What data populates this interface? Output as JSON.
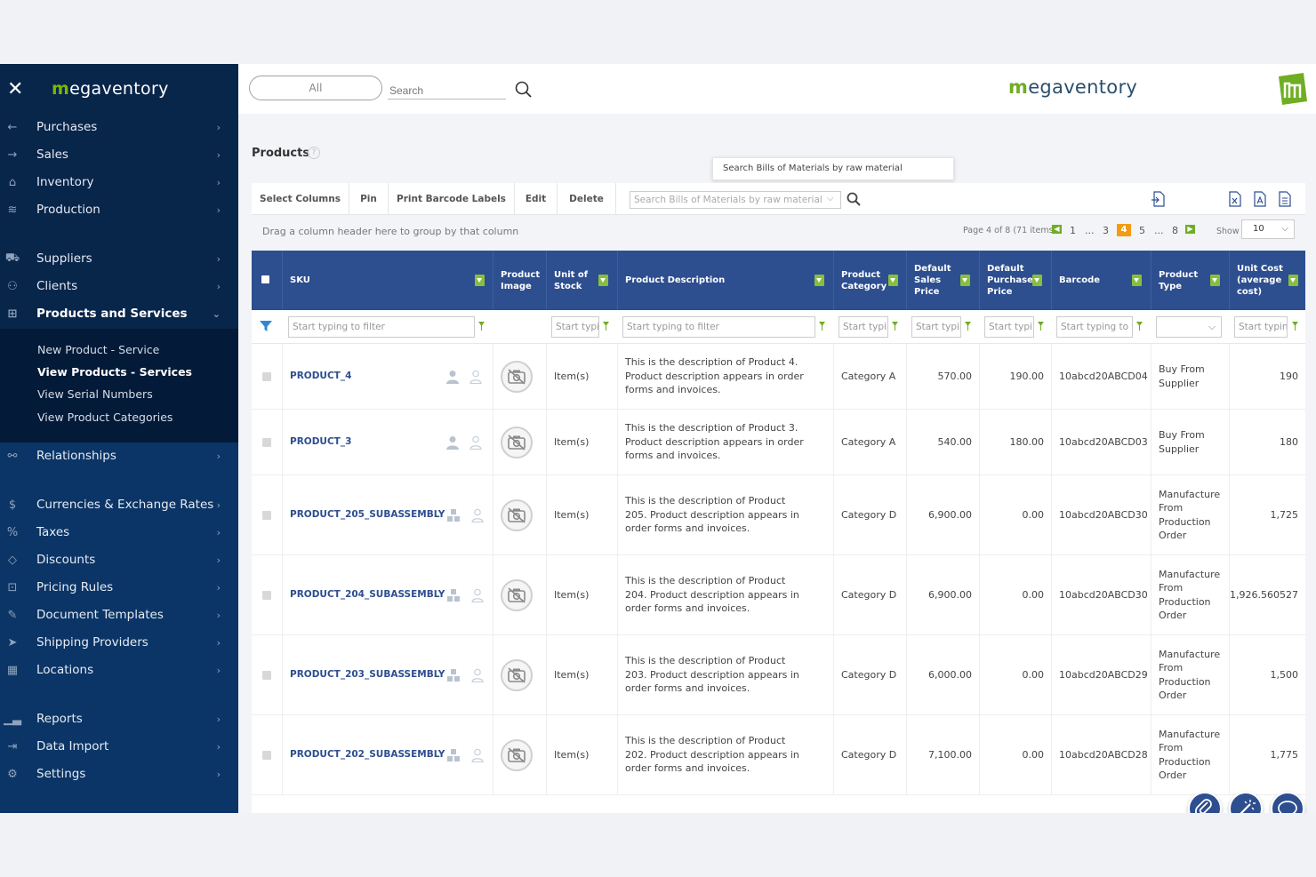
{
  "sidebar": {
    "logo": "megaventory",
    "logo_initial": "m",
    "logo_rest": "egaventory",
    "items_top": [
      {
        "label": "Purchases",
        "icon": "arrow-left-icon"
      },
      {
        "label": "Sales",
        "icon": "arrow-right-icon"
      },
      {
        "label": "Inventory",
        "icon": "warehouse-icon"
      },
      {
        "label": "Production",
        "icon": "layers-icon"
      }
    ],
    "items_mid": [
      {
        "label": "Suppliers",
        "icon": "truck-icon"
      },
      {
        "label": "Clients",
        "icon": "users-icon"
      },
      {
        "label": "Products and Services",
        "icon": "gift-icon"
      }
    ],
    "sub_items": [
      {
        "label": "New Product - Service"
      },
      {
        "label": "View Products - Services"
      },
      {
        "label": "View Serial Numbers"
      },
      {
        "label": "View Product Categories"
      }
    ],
    "items_lower": [
      {
        "label": "Relationships",
        "icon": "network-icon"
      },
      {
        "label": "Currencies & Exchange Rates",
        "icon": "currency-icon"
      },
      {
        "label": "Taxes",
        "icon": "percent-icon"
      },
      {
        "label": "Discounts",
        "icon": "tag-icon"
      },
      {
        "label": "Pricing Rules",
        "icon": "price-rule-icon"
      },
      {
        "label": "Document Templates",
        "icon": "pen-icon"
      },
      {
        "label": "Shipping Providers",
        "icon": "send-icon"
      },
      {
        "label": "Locations",
        "icon": "building-icon"
      },
      {
        "label": "Reports",
        "icon": "chart-icon"
      },
      {
        "label": "Data Import",
        "icon": "import-icon"
      },
      {
        "label": "Settings",
        "icon": "gear-icon"
      }
    ]
  },
  "topbar": {
    "scope": "All",
    "search_placeholder": "Search",
    "brand_initial": "m",
    "brand_rest": "egaventory"
  },
  "page": {
    "title": "Products",
    "tooltip": "Search Bills of Materials by raw material"
  },
  "toolbar": {
    "select_columns": "Select Columns",
    "pin": "Pin",
    "print_barcode": "Print Barcode Labels",
    "edit": "Edit",
    "delete": "Delete",
    "bom_search_placeholder": "Search Bills of Materials by raw material"
  },
  "grouping": {
    "hint": "Drag a column header here to group by that column",
    "pager_text": "Page 4 of 8 (71 items)",
    "pages": [
      "1",
      "...",
      "3",
      "4",
      "5",
      "...",
      "8"
    ],
    "current_page": "4",
    "show_label": "Show",
    "page_size": "10"
  },
  "columns": {
    "sku": "SKU",
    "image": "Product Image",
    "unit": "Unit of Stock",
    "description": "Product Description",
    "category": "Product Category",
    "sales_price": "Default Sales Price",
    "purchase_price": "Default Purchase Price",
    "barcode": "Barcode",
    "type": "Product Type",
    "unit_cost": "Unit Cost (average cost)"
  },
  "filters": {
    "sku": "Start typing to filter",
    "unit": "Start typi",
    "description": "Start typing to filter",
    "category": "Start typi",
    "sales_price": "Start typi",
    "purchase_price": "Start typi",
    "barcode": "Start typing to f",
    "unit_cost": "Start typin"
  },
  "rows": [
    {
      "sku": "PRODUCT_4",
      "unit": "Item(s)",
      "description": "This is the description of Product 4. Product description appears in order forms and invoices.",
      "category": "Category A",
      "sales_price": "570.00",
      "purchase_price": "190.00",
      "barcode": "10abcd20ABCD04",
      "type": "Buy From Supplier",
      "unit_cost": "190"
    },
    {
      "sku": "PRODUCT_3",
      "unit": "Item(s)",
      "description": "This is the description of Product 3. Product description appears in order forms and invoices.",
      "category": "Category A",
      "sales_price": "540.00",
      "purchase_price": "180.00",
      "barcode": "10abcd20ABCD03",
      "type": "Buy From Supplier",
      "unit_cost": "180"
    },
    {
      "sku": "PRODUCT_205_SUBASSEMBLY",
      "unit": "Item(s)",
      "description": "This is the description of Product 205. Product description appears in order forms and invoices.",
      "category": "Category D",
      "sales_price": "6,900.00",
      "purchase_price": "0.00",
      "barcode": "10abcd20ABCD30",
      "type": "Manufacture From Production Order",
      "unit_cost": "1,725"
    },
    {
      "sku": "PRODUCT_204_SUBASSEMBLY",
      "unit": "Item(s)",
      "description": "This is the description of Product 204. Product description appears in order forms and invoices.",
      "category": "Category D",
      "sales_price": "6,900.00",
      "purchase_price": "0.00",
      "barcode": "10abcd20ABCD30",
      "type": "Manufacture From Production Order",
      "unit_cost": "1,926.560527"
    },
    {
      "sku": "PRODUCT_203_SUBASSEMBLY",
      "unit": "Item(s)",
      "description": "This is the description of Product 203. Product description appears in order forms and invoices.",
      "category": "Category D",
      "sales_price": "6,000.00",
      "purchase_price": "0.00",
      "barcode": "10abcd20ABCD29",
      "type": "Manufacture From Production Order",
      "unit_cost": "1,500"
    },
    {
      "sku": "PRODUCT_202_SUBASSEMBLY",
      "unit": "Item(s)",
      "description": "This is the description of Product 202. Product description appears in order forms and invoices.",
      "category": "Category D",
      "sales_price": "7,100.00",
      "purchase_price": "0.00",
      "barcode": "10abcd20ABCD28",
      "type": "Manufacture From Production Order",
      "unit_cost": "1,775"
    }
  ],
  "colors": {
    "sidebar_bg": "#08254a",
    "header_bg": "#2d4e8f",
    "accent_green": "#6fae23",
    "pager_current": "#f39c12"
  }
}
